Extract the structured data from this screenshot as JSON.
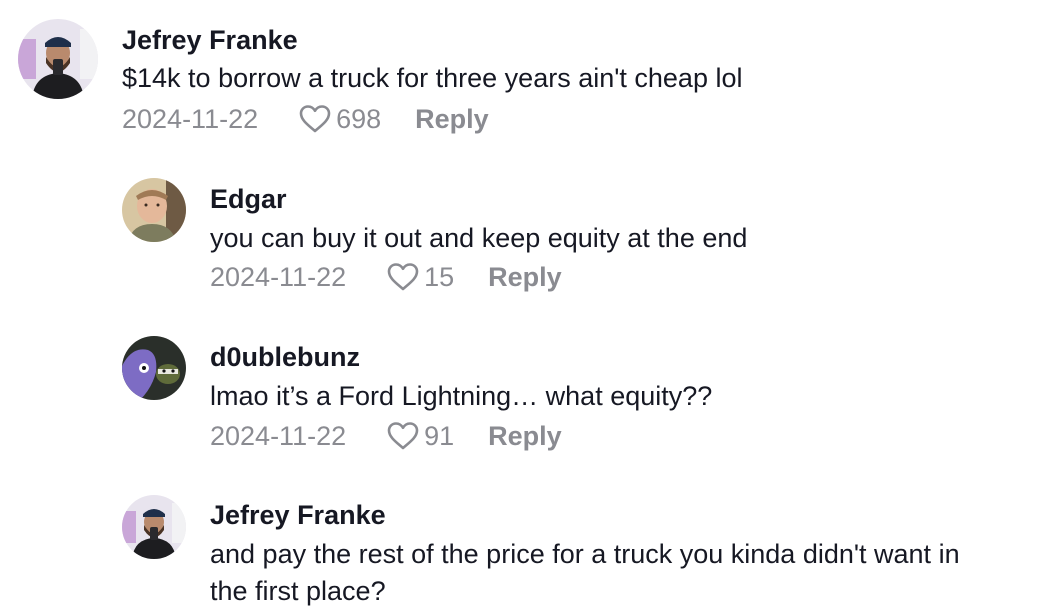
{
  "comments": [
    {
      "username": "Jefrey Franke",
      "text": "$14k to borrow a truck for three years ain't cheap lol",
      "date": "2024-11-22",
      "likes": "698",
      "reply": "Reply"
    },
    {
      "username": "Edgar",
      "text": "you can buy it out and keep equity at the end",
      "date": "2024-11-22",
      "likes": "15",
      "reply": "Reply"
    },
    {
      "username": "d0ublebunz",
      "text": "lmao it’s a Ford Lightning… what equity??",
      "date": "2024-11-22",
      "likes": "91",
      "reply": "Reply"
    },
    {
      "username": "Jefrey Franke",
      "text_line1": "and pay the rest of the price for a truck you kinda didn't want in",
      "text_line2": "the first place?"
    }
  ],
  "colors": {
    "text": "#161823",
    "meta": "#8a8b91"
  }
}
